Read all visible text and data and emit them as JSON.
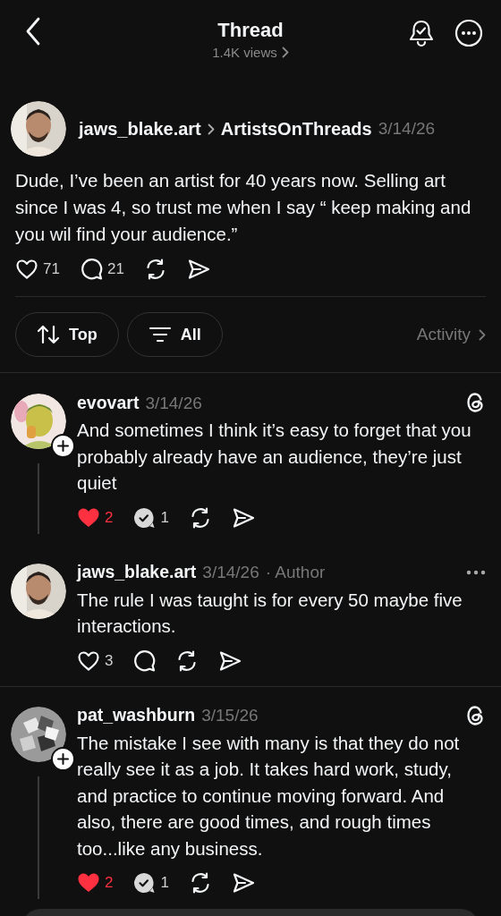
{
  "header": {
    "title": "Thread",
    "views": "1.4K views"
  },
  "post": {
    "username": "jaws_blake.art",
    "community": "ArtistsOnThreads",
    "date": "3/14/26",
    "text": "Dude, I’ve been an artist for 40 years now. Selling art since I was 4, so trust me when I say “ keep making and you wil find your audience.”",
    "liked": false,
    "like_count": "71",
    "replied": false,
    "reply_count": "21"
  },
  "filters": {
    "sort": "Top",
    "filter": "All",
    "activity": "Activity"
  },
  "replies": [
    {
      "username": "evovart",
      "date": "3/14/26",
      "kind": "logo",
      "follow_button": true,
      "has_thread": true,
      "text": "And sometimes I think it’s easy to forget that you probably already have an audience, they’re just quiet",
      "liked": true,
      "like_count": "2",
      "replied": true,
      "reply_count": "1"
    },
    {
      "username": "jaws_blake.art",
      "date": "3/14/26",
      "tag": "· Author",
      "kind": "more",
      "follow_button": false,
      "has_thread": false,
      "text": "The rule I  was taught is for every 50 maybe five interactions.",
      "liked": false,
      "like_count": "3",
      "replied": false
    },
    {
      "username": "pat_washburn",
      "date": "3/15/26",
      "kind": "logo",
      "follow_button": true,
      "has_thread": true,
      "text": "The mistake I see with many is that they do not really see it as a job. It takes hard work, study, and practice to continue moving forward. And also, there are good times, and rough times too...like any business.",
      "liked": true,
      "like_count": "2",
      "replied": true,
      "reply_count": "1"
    }
  ]
}
